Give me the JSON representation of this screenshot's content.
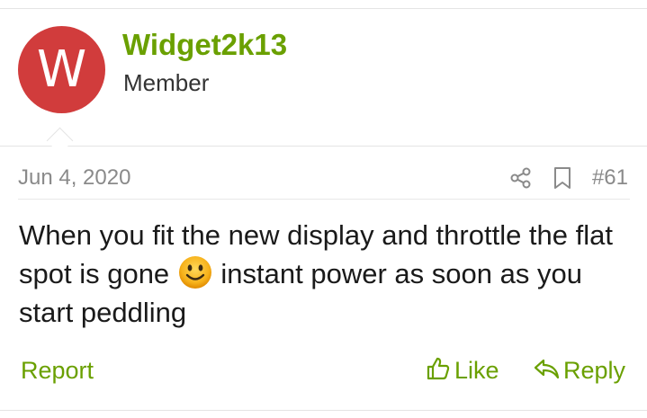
{
  "author": {
    "avatar_letter": "W",
    "username": "Widget2k13",
    "title": "Member"
  },
  "post": {
    "date": "Jun 4, 2020",
    "number": "#61",
    "message_part1": "When you fit the new display and throttle the flat spot is gone",
    "message_part2": "instant power as soon as you start peddling"
  },
  "actions": {
    "report": "Report",
    "like": "Like",
    "reply": "Reply"
  },
  "icons": {
    "share": "share-icon",
    "bookmark": "bookmark-icon",
    "like": "thumbs-up-icon",
    "reply": "reply-arrow-icon",
    "emoji": "smiley-emoji"
  },
  "colors": {
    "accent": "#6aa000",
    "avatar_bg": "#d13c3c",
    "muted_text": "#8a8a8a"
  }
}
